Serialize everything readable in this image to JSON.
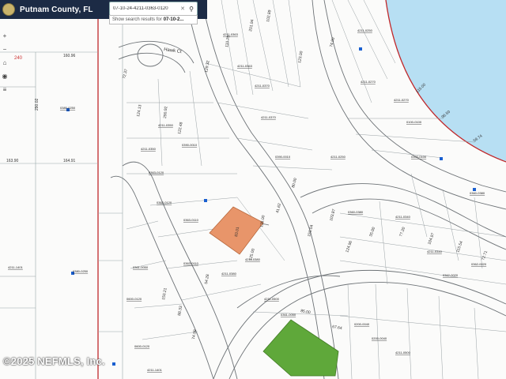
{
  "header": {
    "county_title": "Putnam County, FL"
  },
  "search": {
    "value": "07-10-24-4211-0363-0120",
    "suggestion_prefix": "Show search results for",
    "suggestion_query": "07-10-2..."
  },
  "map": {
    "street_label": "Hawk Ct",
    "selected_parcel_color": "#e8956a",
    "highlight_parcel_color": "#5fa83a",
    "water_color": "#b7dff3",
    "boundary_color": "#c0282b",
    "point_color": "#1a5fd0",
    "dim_labels": [
      "160.96",
      "290.02",
      "163.90",
      "164.91",
      "72.37",
      "124.13",
      "290.92",
      "122.48",
      "129.32",
      "110.75",
      "201.94",
      "102.89",
      "123.00",
      "74.90",
      "83.01",
      "125.00",
      "135.00",
      "41.62",
      "80.00",
      "150.04",
      "103.87",
      "124.96",
      "35.00",
      "77.20",
      "104.97",
      "115.54",
      "72.71",
      "115.00",
      "96.50",
      "59.74",
      "150.21",
      "88.33",
      "74.98",
      "54.28",
      "85.00",
      "67.64"
    ],
    "parcel_ids": [
      "4211-0363",
      "4211-0370",
      "0390-0010",
      "4211-0350",
      "0363-0120",
      "0363-0110",
      "4211-0380",
      "4211-0250",
      "4211-0270",
      "0100-0100",
      "0360-0380",
      "4211-0340",
      "0362-0020",
      "0200-0040",
      "4211-0500",
      "0361-0050",
      "0600-0120",
      "4211-1401",
      "0380-0250"
    ],
    "red_marker": "240"
  },
  "footer": {
    "watermark": "©2025 NEFMLS, Inc."
  }
}
